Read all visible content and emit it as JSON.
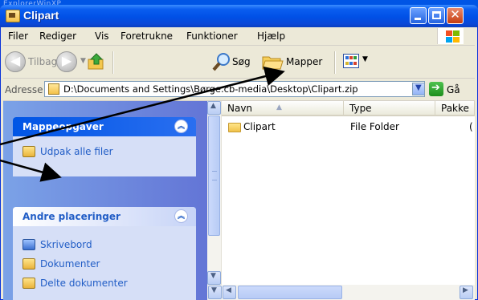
{
  "window": {
    "title": "Clipart"
  },
  "desktop_text": "ExplorerWinXP",
  "menu": [
    "Filer",
    "Rediger",
    "Vis",
    "Foretrukne",
    "Funktioner",
    "Hjælp"
  ],
  "toolbar": {
    "back_label": "Tilbage",
    "search_label": "Søg",
    "folders_label": "Mapper"
  },
  "address": {
    "label": "Adresse",
    "path": "D:\\Documents and Settings\\Børge.cb-media\\Desktop\\Clipart.zip",
    "go_label": "Gå"
  },
  "tasks_panel": {
    "title": "Mappeopgaver",
    "items": [
      {
        "label": "Udpak alle filer",
        "icon": "extract-icon"
      }
    ]
  },
  "places_panel": {
    "title": "Andre placeringer",
    "items": [
      {
        "label": "Skrivebord",
        "icon": "desktop-icon"
      },
      {
        "label": "Dokumenter",
        "icon": "documents-icon"
      },
      {
        "label": "Delte dokumenter",
        "icon": "shared-folder-icon"
      }
    ]
  },
  "columns": [
    "Navn",
    "Type",
    "Pakke"
  ],
  "rows": [
    {
      "name": "Clipart",
      "type": "File Folder",
      "packed": "("
    }
  ],
  "colors": {
    "title_blue": "#0055e5",
    "task_pane": "#6375d6",
    "window_bg": "#ece9d8",
    "close_red": "#c63d10"
  }
}
